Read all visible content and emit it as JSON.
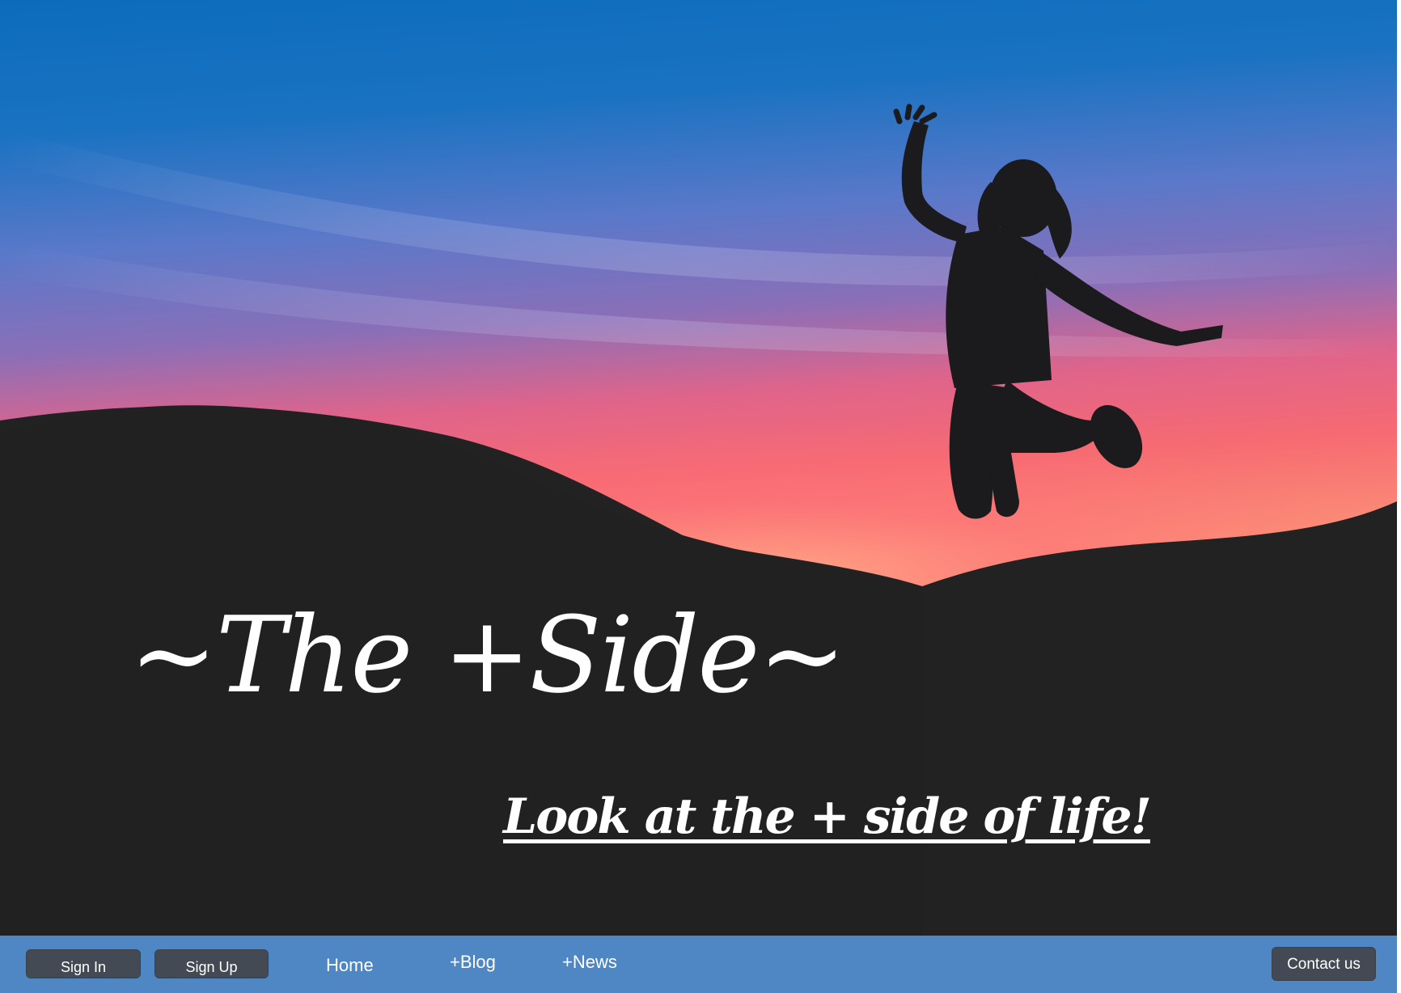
{
  "hero": {
    "title": "~The +Side~",
    "tagline": "Look at the + side of life!"
  },
  "navbar": {
    "sign_in_label": "Sign In",
    "sign_up_label": "Sign Up",
    "links": [
      "Home",
      "+Blog",
      "+News"
    ],
    "contact_label": "Contact us"
  },
  "colors": {
    "navbar_bg": "#4f87c4",
    "button_bg": "#434a53",
    "hero_dark": "#222222",
    "sky_top": "#0d6fbe",
    "sunset_pink": "#f4607a"
  }
}
